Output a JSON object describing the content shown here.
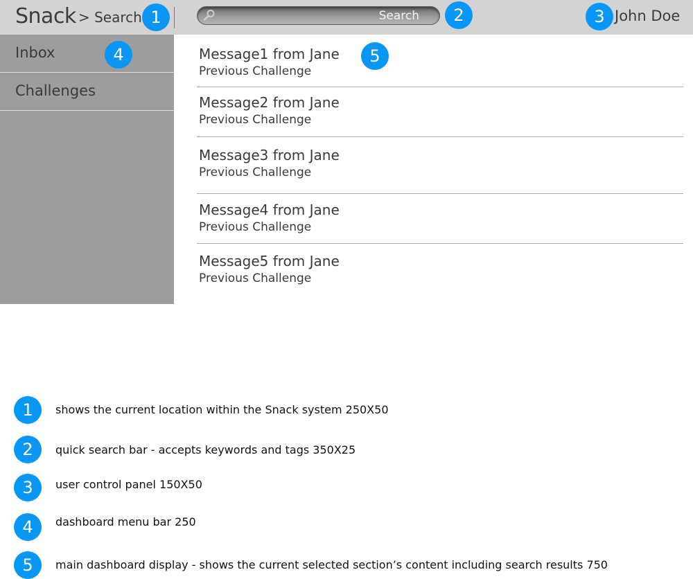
{
  "header": {
    "brand": "Snack",
    "breadcrumb": "> Search",
    "search_placeholder": "Search",
    "user_name": "John Doe"
  },
  "sidebar": {
    "items": [
      {
        "label": "Inbox"
      },
      {
        "label": "Challenges"
      }
    ]
  },
  "messages": [
    {
      "title": "Message1 from Jane",
      "subtitle": "Previous Challenge"
    },
    {
      "title": "Message2 from Jane",
      "subtitle": "Previous Challenge"
    },
    {
      "title": "Message3 from Jane",
      "subtitle": "Previous Challenge"
    },
    {
      "title": "Message4 from Jane",
      "subtitle": "Previous Challenge"
    },
    {
      "title": "Message5 from Jane",
      "subtitle": "Previous Challenge"
    }
  ],
  "callouts": [
    "1",
    "2",
    "3",
    "4",
    "5"
  ],
  "legend": [
    {
      "num": "1",
      "text": "shows the current location within the Snack system 250X50"
    },
    {
      "num": "2",
      "text": "quick search bar - accepts keywords and tags 350X25"
    },
    {
      "num": "3",
      "text": "user control panel 150X50"
    },
    {
      "num": "4",
      "text": "dashboard menu bar 250"
    },
    {
      "num": "5",
      "text": "main dashboard display - shows the current selected section’s content including search results 750"
    }
  ],
  "colors": {
    "badge": "#0a96f5",
    "header_bg": "#d3d3d3",
    "sidebar_bg": "#9d9d9d"
  }
}
